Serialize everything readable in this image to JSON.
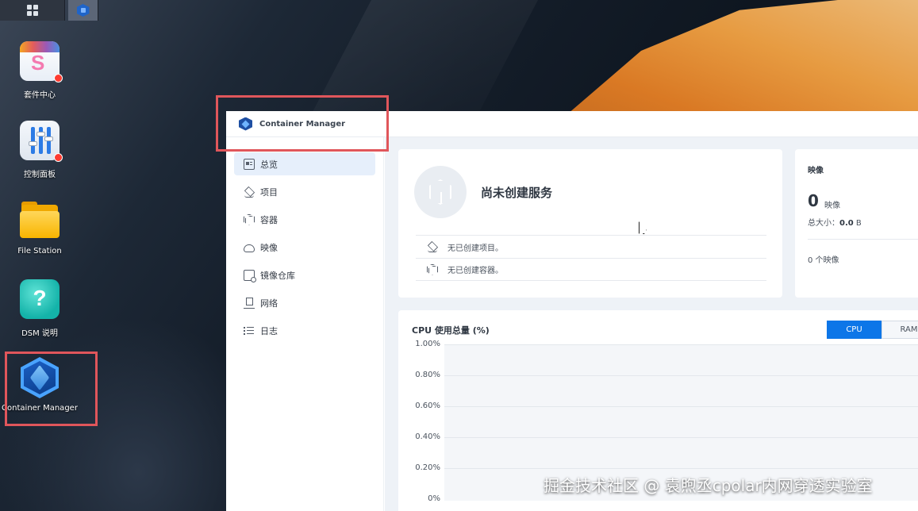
{
  "desktop": {
    "icons": [
      {
        "label": "套件中心",
        "badge": true
      },
      {
        "label": "控制面板",
        "badge": true
      },
      {
        "label": "File Station"
      },
      {
        "label": "DSM 说明"
      },
      {
        "label": "Container Manager"
      }
    ]
  },
  "taskbar": {
    "main_menu_icon": "grid-icon",
    "open_app_icon": "container-manager-icon"
  },
  "window": {
    "title": "Container Manager"
  },
  "sidebar": {
    "items": [
      {
        "label": "总览",
        "icon": "overview-icon",
        "active": true
      },
      {
        "label": "项目",
        "icon": "layers-icon"
      },
      {
        "label": "容器",
        "icon": "cube-icon"
      },
      {
        "label": "映像",
        "icon": "cloud-icon"
      },
      {
        "label": "镜像仓库",
        "icon": "registry-icon"
      },
      {
        "label": "网络",
        "icon": "network-icon"
      },
      {
        "label": "日志",
        "icon": "log-icon"
      }
    ]
  },
  "service_card": {
    "title": "尚未创建服务",
    "rows": [
      {
        "text": "无已创建项目。",
        "icon": "layers-icon"
      },
      {
        "text": "无已创建容器。",
        "icon": "cube-icon"
      }
    ]
  },
  "image_card": {
    "title": "映像",
    "count": "0",
    "count_label": "映像",
    "size_label": "总大小：",
    "size_value": "0.0",
    "size_unit": "B",
    "summary": "0 个映像"
  },
  "cpu_card": {
    "title": "CPU 使用总量 (%)",
    "tabs": [
      "CPU",
      "RAM"
    ],
    "active_tab": "CPU",
    "y_ticks": [
      "1.00%",
      "0.80%",
      "0.60%",
      "0.40%",
      "0.20%",
      "0%"
    ]
  },
  "watermark": "掘金技术社区 @ 袁煦丞cpolar内网穿透实验室",
  "colors": {
    "accent": "#0d76e8",
    "highlight_box": "#e0565b",
    "active_nav": "#e6effb"
  }
}
